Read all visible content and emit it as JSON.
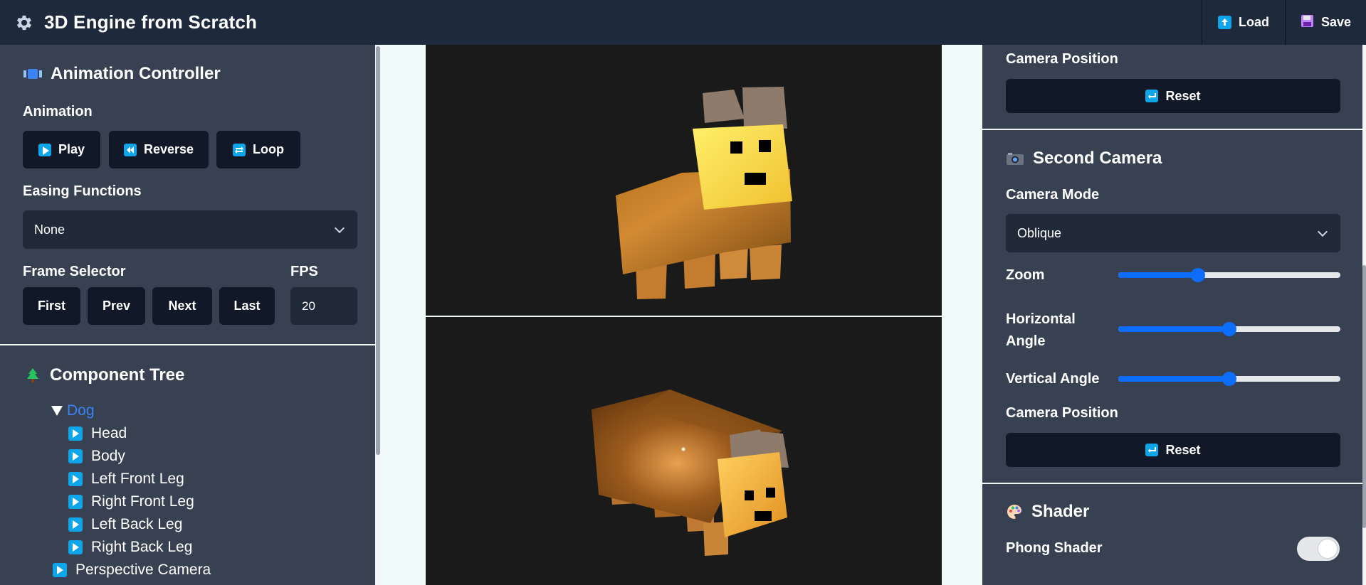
{
  "app": {
    "title": "3D Engine from Scratch"
  },
  "header": {
    "load_label": "Load",
    "save_label": "Save"
  },
  "animation_controller": {
    "title": "Animation Controller",
    "animation_label": "Animation",
    "play_label": "Play",
    "reverse_label": "Reverse",
    "loop_label": "Loop",
    "easing_label": "Easing Functions",
    "easing_value": "None",
    "frame_selector_label": "Frame Selector",
    "first_label": "First",
    "prev_label": "Prev",
    "next_label": "Next",
    "last_label": "Last",
    "fps_label": "FPS",
    "fps_value": "20"
  },
  "component_tree": {
    "title": "Component Tree",
    "root": "Dog",
    "children": [
      "Head",
      "Body",
      "Left Front Leg",
      "Right Front Leg",
      "Left Back Leg",
      "Right Back Leg"
    ],
    "sibling": "Perspective Camera"
  },
  "first_camera": {
    "position_label": "Camera Position",
    "reset_label": "Reset"
  },
  "second_camera": {
    "title": "Second Camera",
    "mode_label": "Camera Mode",
    "mode_value": "Oblique",
    "zoom_label": "Zoom",
    "zoom_value": 0.36,
    "horizontal_label": "Horizontal Angle",
    "horizontal_value": 0.5,
    "vertical_label": "Vertical Angle",
    "vertical_value": 0.5,
    "position_label": "Camera Position",
    "reset_label": "Reset"
  },
  "shader": {
    "title": "Shader",
    "phong_label": "Phong Shader",
    "phong_enabled": true
  },
  "colors": {
    "header_bg": "#1e293b",
    "panel_bg": "#374151",
    "button_bg": "#111827",
    "accent": "#0ea5e9",
    "slider": "#0d6efd",
    "viewport_bg": "#1a1a1a",
    "tree_root": "#3b82f6"
  }
}
